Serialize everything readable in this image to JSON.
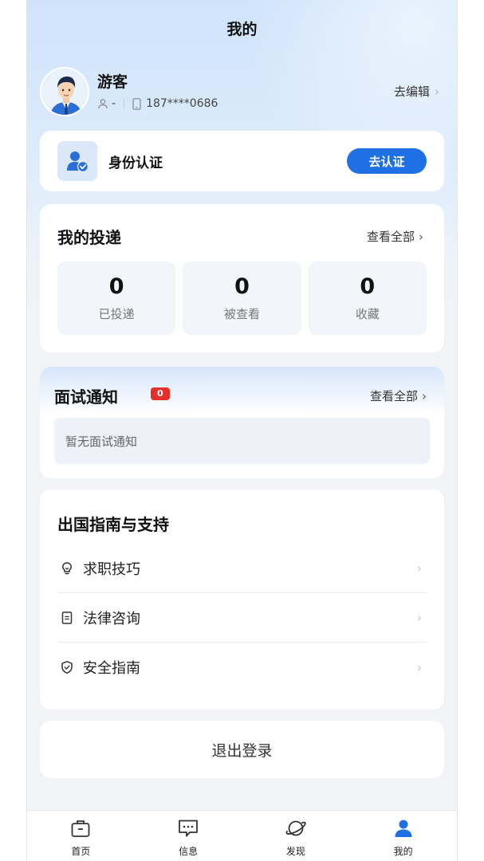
{
  "header": {
    "title": "我的"
  },
  "profile": {
    "name": "游客",
    "gender_value": "-",
    "phone": "187****0686",
    "edit_label": "去编辑"
  },
  "verify": {
    "label": "身份认证",
    "button": "去认证"
  },
  "deliveries": {
    "title": "我的投递",
    "see_all": "查看全部",
    "stats": [
      {
        "value": "0",
        "label": "已投递"
      },
      {
        "value": "0",
        "label": "被查看"
      },
      {
        "value": "0",
        "label": "收藏"
      }
    ]
  },
  "interview": {
    "title": "面试通知",
    "badge": "0",
    "see_all": "查看全部",
    "empty_text": "暂无面试通知"
  },
  "guide": {
    "title": "出国指南与支持",
    "items": [
      {
        "label": "求职技巧",
        "icon": "lightbulb-icon"
      },
      {
        "label": "法律咨询",
        "icon": "document-icon"
      },
      {
        "label": "安全指南",
        "icon": "shield-icon"
      }
    ]
  },
  "logout": {
    "label": "退出登录"
  },
  "tabbar": {
    "items": [
      {
        "label": "首页",
        "icon": "briefcase-icon"
      },
      {
        "label": "信息",
        "icon": "message-icon"
      },
      {
        "label": "发现",
        "icon": "planet-icon"
      },
      {
        "label": "我的",
        "icon": "user-icon"
      }
    ],
    "active_index": 3
  },
  "colors": {
    "accent": "#1f6fe5",
    "badge": "#e52f28",
    "page_bg": "#f1f3f7"
  }
}
